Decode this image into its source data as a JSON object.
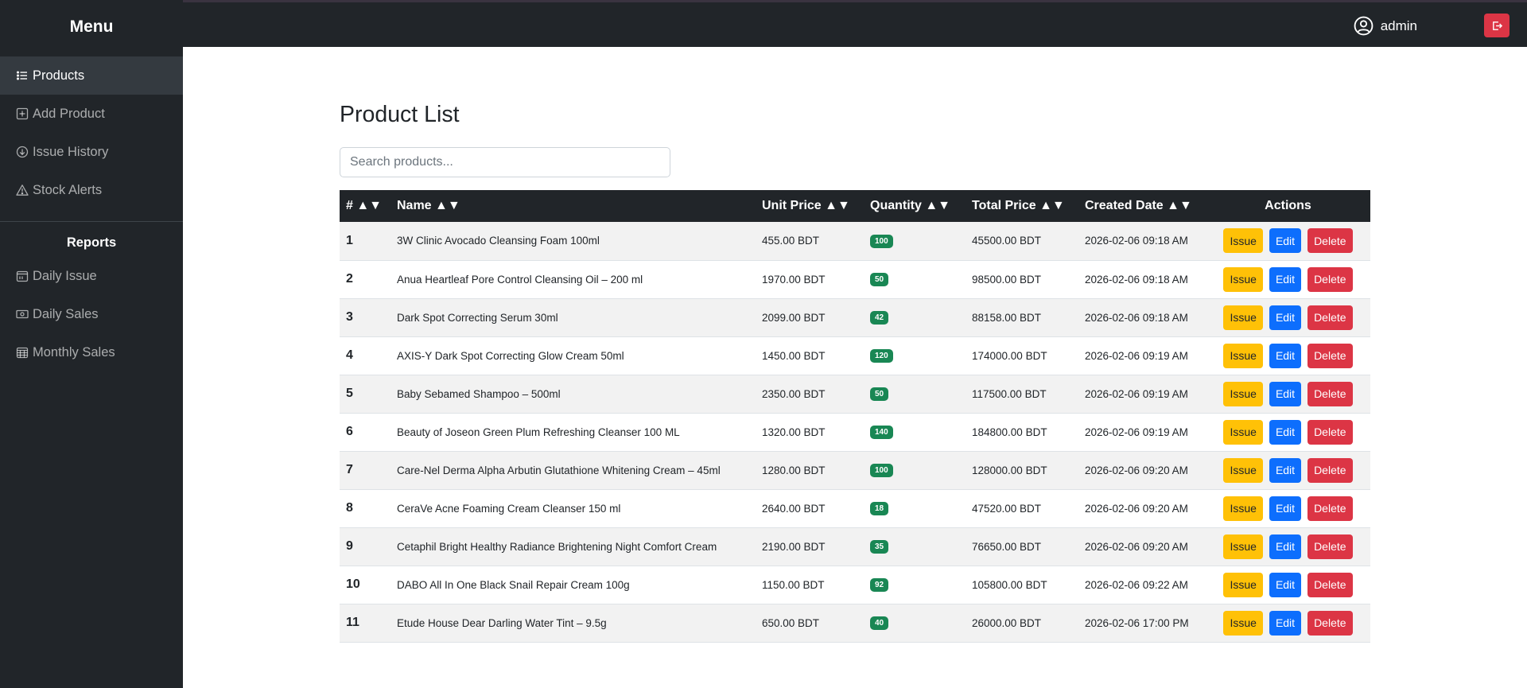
{
  "sidebar": {
    "title": "Menu",
    "items": [
      {
        "label": "Products",
        "icon": "list-icon"
      },
      {
        "label": "Add Product",
        "icon": "plus-square-icon"
      },
      {
        "label": "Issue History",
        "icon": "arrow-down-circle-icon"
      },
      {
        "label": "Stock Alerts",
        "icon": "warning-triangle-icon"
      }
    ],
    "reports_heading": "Reports",
    "report_items": [
      {
        "label": "Daily Issue",
        "icon": "calendar-icon"
      },
      {
        "label": "Daily Sales",
        "icon": "cash-icon"
      },
      {
        "label": "Monthly Sales",
        "icon": "calendar-grid-icon"
      }
    ]
  },
  "header": {
    "username": "admin",
    "user_icon": "user-circle-icon",
    "logout_icon": "logout-icon"
  },
  "main": {
    "title": "Product List",
    "search_placeholder": "Search products...",
    "columns": [
      "# ▲▼",
      "Name ▲▼",
      "Unit Price ▲▼",
      "Quantity ▲▼",
      "Total Price ▲▼",
      "Created Date ▲▼",
      "Actions"
    ],
    "action_labels": {
      "issue": "Issue",
      "edit": "Edit",
      "delete": "Delete"
    },
    "rows": [
      {
        "id": "1",
        "name": "3W Clinic Avocado Cleansing Foam 100ml",
        "unit_price": "455.00 BDT",
        "quantity": "100",
        "total_price": "45500.00 BDT",
        "created": "2026-02-06 09:18 AM"
      },
      {
        "id": "2",
        "name": "Anua Heartleaf Pore Control Cleansing Oil – 200 ml",
        "unit_price": "1970.00 BDT",
        "quantity": "50",
        "total_price": "98500.00 BDT",
        "created": "2026-02-06 09:18 AM"
      },
      {
        "id": "3",
        "name": "Dark Spot Correcting Serum 30ml",
        "unit_price": "2099.00 BDT",
        "quantity": "42",
        "total_price": "88158.00 BDT",
        "created": "2026-02-06 09:18 AM"
      },
      {
        "id": "4",
        "name": "AXIS-Y Dark Spot Correcting Glow Cream 50ml",
        "unit_price": "1450.00 BDT",
        "quantity": "120",
        "total_price": "174000.00 BDT",
        "created": "2026-02-06 09:19 AM"
      },
      {
        "id": "5",
        "name": "Baby Sebamed Shampoo – 500ml",
        "unit_price": "2350.00 BDT",
        "quantity": "50",
        "total_price": "117500.00 BDT",
        "created": "2026-02-06 09:19 AM"
      },
      {
        "id": "6",
        "name": "Beauty of Joseon Green Plum Refreshing Cleanser 100 ML",
        "unit_price": "1320.00 BDT",
        "quantity": "140",
        "total_price": "184800.00 BDT",
        "created": "2026-02-06 09:19 AM"
      },
      {
        "id": "7",
        "name": "Care-Nel Derma Alpha Arbutin Glutathione Whitening Cream – 45ml",
        "unit_price": "1280.00 BDT",
        "quantity": "100",
        "total_price": "128000.00 BDT",
        "created": "2026-02-06 09:20 AM"
      },
      {
        "id": "8",
        "name": "CeraVe Acne Foaming Cream Cleanser 150 ml",
        "unit_price": "2640.00 BDT",
        "quantity": "18",
        "total_price": "47520.00 BDT",
        "created": "2026-02-06 09:20 AM"
      },
      {
        "id": "9",
        "name": "Cetaphil Bright Healthy Radiance Brightening Night Comfort Cream",
        "unit_price": "2190.00 BDT",
        "quantity": "35",
        "total_price": "76650.00 BDT",
        "created": "2026-02-06 09:20 AM"
      },
      {
        "id": "10",
        "name": "DABO All In One Black Snail Repair Cream 100g",
        "unit_price": "1150.00 BDT",
        "quantity": "92",
        "total_price": "105800.00 BDT",
        "created": "2026-02-06 09:22 AM"
      },
      {
        "id": "11",
        "name": "Etude House Dear Darling Water Tint – 9.5g",
        "unit_price": "650.00 BDT",
        "quantity": "40",
        "total_price": "26000.00 BDT",
        "created": "2026-02-06 17:00 PM"
      }
    ]
  },
  "colors": {
    "dark": "#212529",
    "active_nav": "#343a40",
    "issue": "#ffc107",
    "edit": "#0d6efd",
    "delete": "#dc3545",
    "badge": "#198754"
  }
}
